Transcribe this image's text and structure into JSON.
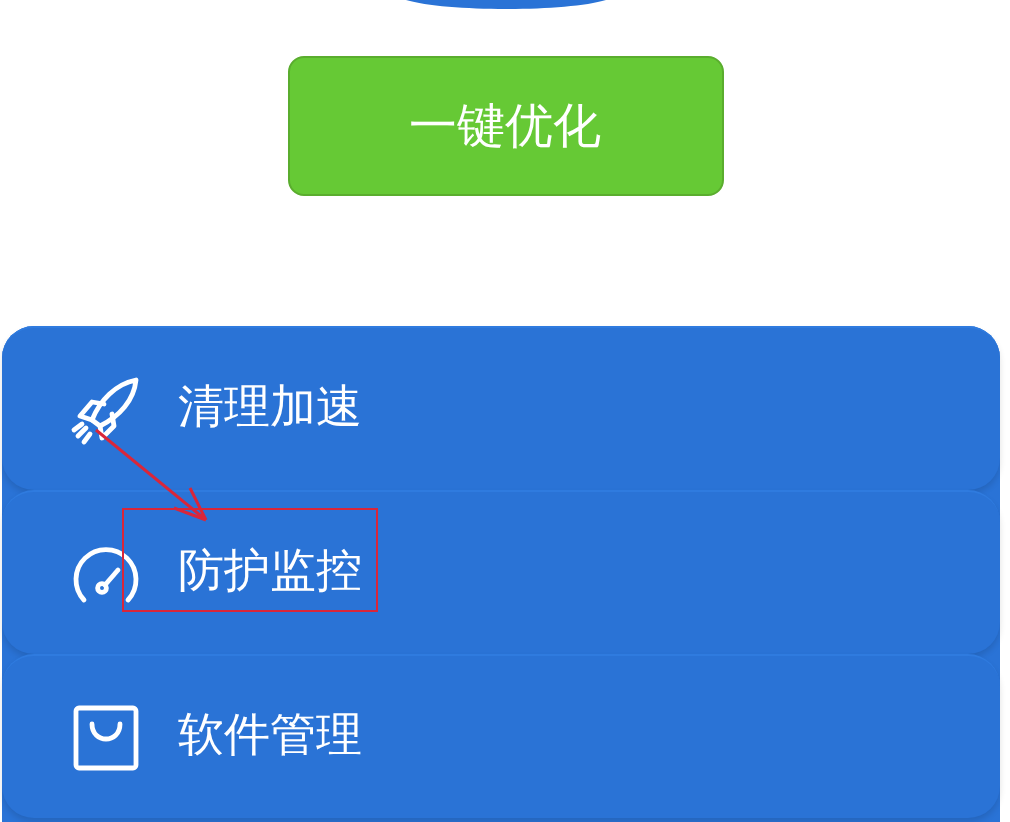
{
  "action_button": {
    "label": "一键优化"
  },
  "menu": [
    {
      "kind": "rocket",
      "label": "清理加速",
      "highlighted": false
    },
    {
      "kind": "gauge",
      "label": "防护监控",
      "highlighted": true
    },
    {
      "kind": "bag",
      "label": "软件管理",
      "highlighted": false
    }
  ]
}
